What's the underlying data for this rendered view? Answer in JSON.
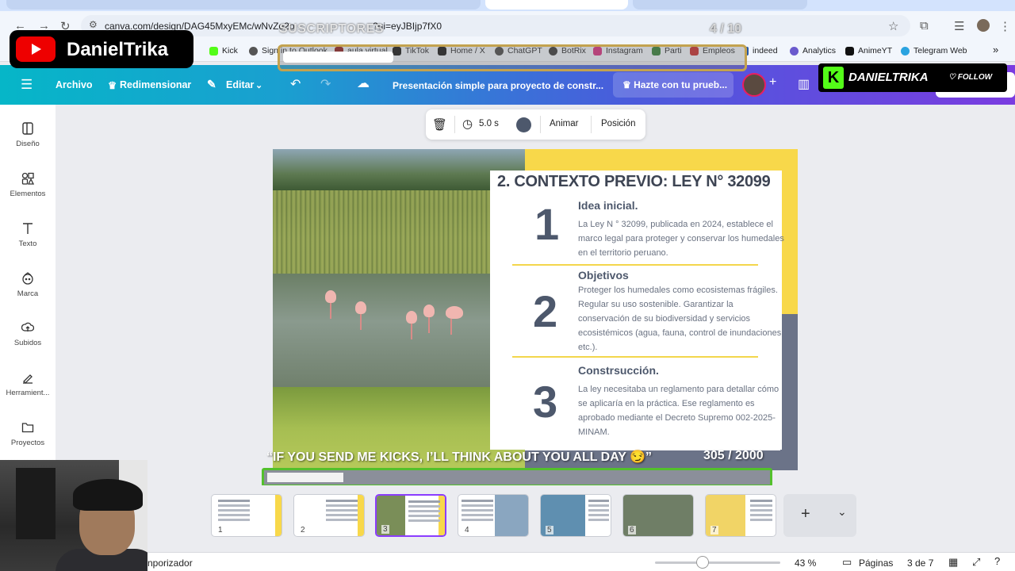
{
  "browser": {
    "url": "canva.com/design/DAG45MxyEMc/wNvZo2p",
    "url_tail": "?ui=eyJBIjp7fX0",
    "bookmarks": [
      {
        "label": "Kick",
        "icon": "kick-icon",
        "color": "#53fc18"
      },
      {
        "label": "Sign in to Outlook",
        "icon": "globe-icon",
        "color": "#555"
      },
      {
        "label": "aula virtual",
        "icon": "aula-icon",
        "color": "#8b1a1a"
      },
      {
        "label": "TikTok",
        "icon": "tiktok-icon",
        "color": "#111"
      },
      {
        "label": "Home / X",
        "icon": "x-icon",
        "color": "#111"
      },
      {
        "label": "ChatGPT",
        "icon": "chatgpt-icon",
        "color": "#444"
      },
      {
        "label": "BotRix",
        "icon": "botrix-icon",
        "color": "#333"
      },
      {
        "label": "Instagram",
        "icon": "instagram-icon",
        "color": "#d6297b"
      },
      {
        "label": "Parti",
        "icon": "parti-icon",
        "color": "#2e7d32"
      },
      {
        "label": "Empleos",
        "icon": "empleos-icon",
        "color": "#c62828"
      },
      {
        "label": "indeed",
        "icon": "indeed-icon",
        "color": "#2557a7"
      },
      {
        "label": "Analytics",
        "icon": "analytics-icon",
        "color": "#6a5acd"
      },
      {
        "label": "AnimeYT",
        "icon": "animeyt-icon",
        "color": "#111"
      },
      {
        "label": "Telegram Web",
        "icon": "telegram-icon",
        "color": "#2aa3e0"
      }
    ]
  },
  "overlay": {
    "youtube_name": "DanielTrika",
    "subs_label": "SUSCRIPTORES",
    "subs_count": "4 / 10",
    "subs_progress": 0.4,
    "kick_name": "DANIELTRIKA",
    "kick_follow": "FOLLOW",
    "kick_message": "“IF YOU SEND ME KICKS, I’LL THINK ABOUT YOU ALL DAY 😏”",
    "kick_count": "305 / 2000",
    "kick_progress": 0.1525
  },
  "topbar": {
    "archivo": "Archivo",
    "redimensionar": "Redimensionar",
    "editar": "Editar",
    "doc_title": "Presentación simple para proyecto de constr...",
    "promo": "Hazte con tu prueb..."
  },
  "sidebar": [
    {
      "label": "Diseño",
      "icon": "design-icon"
    },
    {
      "label": "Elementos",
      "icon": "elements-icon"
    },
    {
      "label": "Texto",
      "icon": "text-icon"
    },
    {
      "label": "Marca",
      "icon": "brand-icon"
    },
    {
      "label": "Subidos",
      "icon": "upload-icon"
    },
    {
      "label": "Herramient...",
      "icon": "tools-icon"
    },
    {
      "label": "Proyectos",
      "icon": "folder-icon"
    }
  ],
  "toolbar": {
    "duration": "5.0 s",
    "animar": "Animar",
    "posicion": "Posición"
  },
  "slide": {
    "title": "2. CONTEXTO PREVIO: LEY N° 32099",
    "items": [
      {
        "num": "1",
        "heading": "Idea inicial.",
        "body": "La Ley N ° 32099, publicada en 2024, establece el marco legal para proteger y conservar los humedales en el territorio peruano."
      },
      {
        "num": "2",
        "heading": "Objetivos",
        "body": "Proteger los humedales como ecosistemas frágiles. Regular su uso sostenible. Garantizar la conservación de su biodiversidad y servicios ecosistémicos (agua, fauna, control de inundaciones, etc.)."
      },
      {
        "num": "3",
        "heading": "Constrsucción.",
        "body": "La ley necesitaba un reglamento para detallar cómo se aplicaría en la práctica. Ese reglamento es aprobado mediante el Decreto Supremo 002-2025-MINAM."
      }
    ]
  },
  "thumbnails": [
    {
      "num": "1"
    },
    {
      "num": "2"
    },
    {
      "num": "3"
    },
    {
      "num": "4"
    },
    {
      "num": "5"
    },
    {
      "num": "6"
    },
    {
      "num": "7"
    }
  ],
  "status": {
    "timer": "nporizador",
    "zoom": "43 %",
    "paginas": "Páginas",
    "page_of": "3 de 7"
  }
}
